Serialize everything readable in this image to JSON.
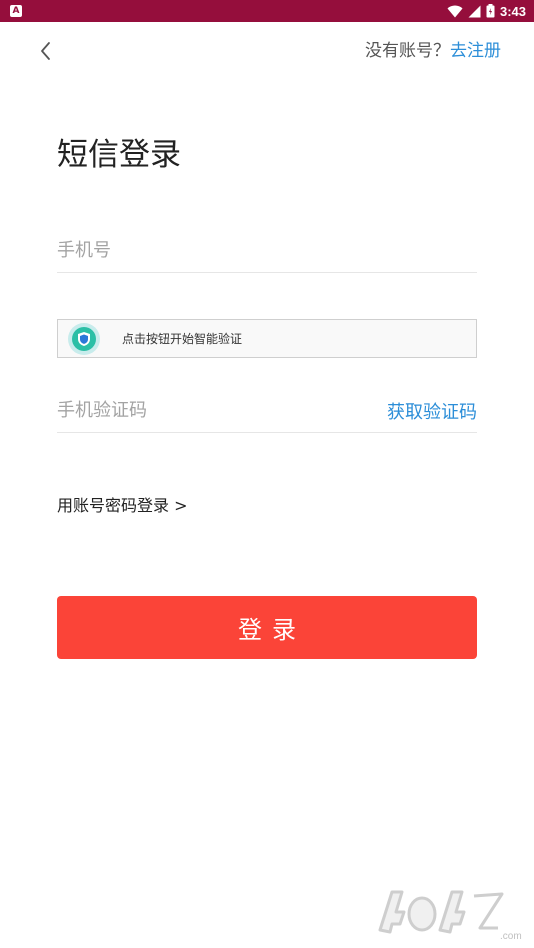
{
  "status_bar": {
    "app_icon": "A",
    "time": "3:43",
    "icons": [
      "wifi-icon",
      "cell-signal-icon",
      "battery-icon"
    ],
    "background": "#950e3c"
  },
  "header": {
    "back_icon": "chevron-left-icon",
    "no_account_text": "没有账号？",
    "register_link": "去注册"
  },
  "page_title": "短信登录",
  "phone": {
    "placeholder": "手机号",
    "value": ""
  },
  "smart_verify": {
    "icon": "shield-icon",
    "label": "点击按钮开始智能验证"
  },
  "code": {
    "placeholder": "手机验证码",
    "value": "",
    "get_code_label": "获取验证码"
  },
  "account_login_link": "用账号密码登录 >",
  "login_button": {
    "label": "登录",
    "color": "#fb4438"
  },
  "colors": {
    "accent_link": "#2c8ed8",
    "verify_shield": "#2bbfa6"
  },
  "watermark": {
    "text": "4o4z.com"
  }
}
